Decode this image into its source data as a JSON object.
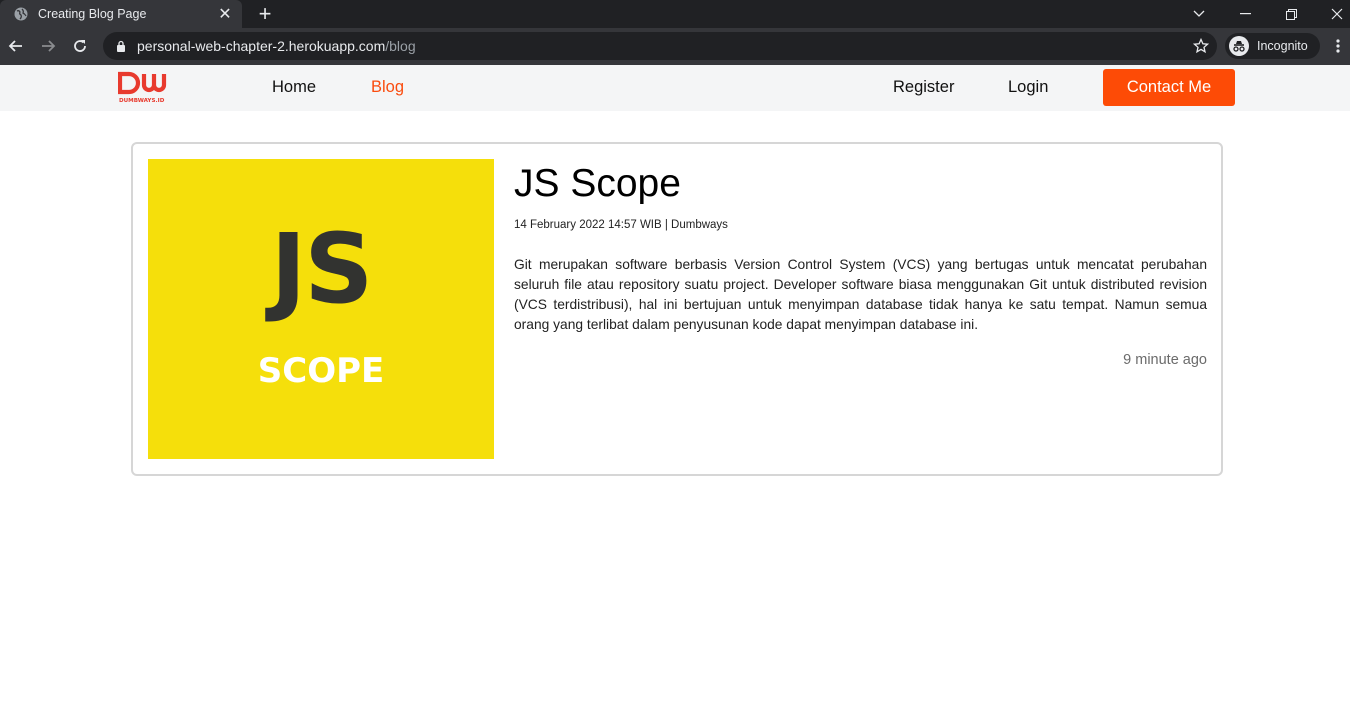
{
  "browser": {
    "tab_title": "Creating Blog Page",
    "url_host": "personal-web-chapter-2.herokuapp.com",
    "url_path": "/blog",
    "incognito_label": "Incognito"
  },
  "nav": {
    "links": [
      {
        "label": "Home",
        "active": false
      },
      {
        "label": "Blog",
        "active": true
      }
    ],
    "register_label": "Register",
    "login_label": "Login",
    "contact_label": "Contact Me",
    "logo_alt": "DUMBWAYS.ID"
  },
  "post": {
    "image_title": "JS",
    "image_subtitle": "SCOPE",
    "title": "JS Scope",
    "meta": "14 February 2022 14:57 WIB | Dumbways",
    "body": "Git merupakan software berbasis Version Control System (VCS) yang bertugas untuk mencatat perubahan seluruh file atau repository suatu project. Developer software biasa menggunakan Git untuk distributed revision (VCS terdistribusi), hal ini bertujuan untuk menyimpan database tidak hanya ke satu tempat. Namun semua orang yang terlibat dalam penyusunan kode dapat menyimpan database ini.",
    "time_ago": "9 minute ago"
  },
  "colors": {
    "accent": "#fd4b06",
    "thumb_bg": "#f5df0b"
  }
}
